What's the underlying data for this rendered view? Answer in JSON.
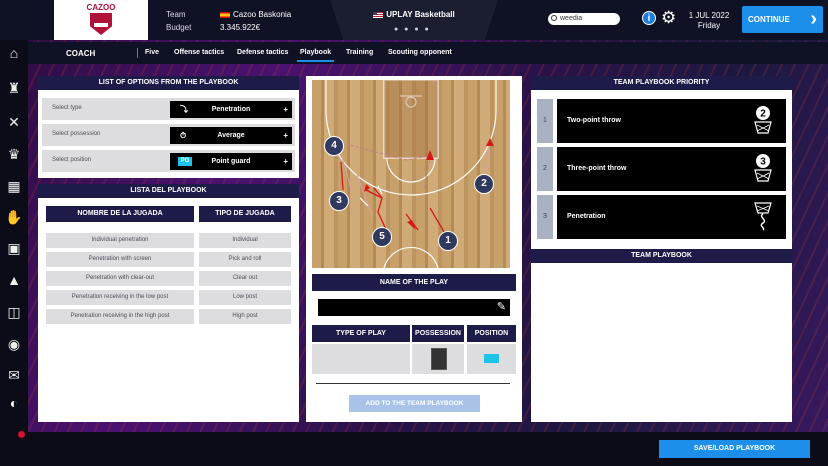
{
  "header": {
    "logo_text": "CAZOO",
    "team_label": "Team",
    "team_value": "Cazoo Baskonia",
    "budget_label": "Budget",
    "budget_value": "3.345.922€",
    "league": "UPLAY Basketball",
    "league_dots": "● ● ● ●",
    "search_value": "weedia",
    "date_line1": "1 JUL 2022",
    "date_line2": "Friday",
    "continue_label": "CONTINUE"
  },
  "subnav": {
    "section": "COACH",
    "tabs": [
      {
        "label": "Five"
      },
      {
        "label": "Offense tactics"
      },
      {
        "label": "Defense tactics"
      },
      {
        "label": "Playbook",
        "active": true
      },
      {
        "label": "Training"
      },
      {
        "label": "Scouting opponent"
      }
    ]
  },
  "options_panel": {
    "title": "LIST OF OPTIONS FROM THE PLAYBOOK",
    "rows": [
      {
        "label": "Select type",
        "value": "Penetration",
        "icon": "drive-icon"
      },
      {
        "label": "Select possession",
        "value": "Average",
        "icon": "stopwatch-icon"
      },
      {
        "label": "Select position",
        "value": "Point guard",
        "tag": "PG"
      }
    ]
  },
  "playbook_list": {
    "title": "LISTA DEL PLAYBOOK",
    "headers": [
      "NOMBRE DE LA JUGADA",
      "TIPO DE JUGADA"
    ],
    "rows": [
      [
        "Individual penetration",
        "Individual"
      ],
      [
        "Penetration with screen",
        "Pick and roll"
      ],
      [
        "Penetration with clear-out",
        "Clear out"
      ],
      [
        "Penetration receiving in the low post",
        "Low post"
      ],
      [
        "Penetration receiving in the high post",
        "High post"
      ]
    ]
  },
  "play_editor": {
    "players": [
      "1",
      "2",
      "3",
      "4",
      "5"
    ],
    "name_header": "NAME OF THE PLAY",
    "name_value": "",
    "col_type": "TYPE OF PLAY",
    "col_possession": "POSSESSION",
    "col_position": "POSITION",
    "add_button": "ADD TO THE TEAM PLAYBOOK",
    "position_color": "#1ec3e8"
  },
  "priority_panel": {
    "title": "TEAM PLAYBOOK PRIORITY",
    "rows": [
      {
        "num": "1",
        "label": "Two-point throw",
        "icon": "two-point-basket-icon",
        "icon_num": "2"
      },
      {
        "num": "2",
        "label": "Three-point throw",
        "icon": "three-point-basket-icon",
        "icon_num": "3"
      },
      {
        "num": "3",
        "label": "Penetration",
        "icon": "penetration-basket-icon",
        "icon_num": ""
      }
    ],
    "team_playbook_title": "TEAM PLAYBOOK"
  },
  "footer": {
    "save_load_label": "SAVE/LOAD PLAYBOOK"
  },
  "nav_icons": [
    "home-icon",
    "jersey-icon",
    "tactics-icon",
    "trophy-icon",
    "calendar-icon",
    "handshake-icon",
    "scoreboard-icon",
    "stats-icon",
    "stadium-icon",
    "profile-icon",
    "mail-icon",
    "twitter-icon"
  ],
  "colors": {
    "accent": "#1d8fea",
    "header_navy": "#1d1c49",
    "team_red": "#b0123a"
  }
}
